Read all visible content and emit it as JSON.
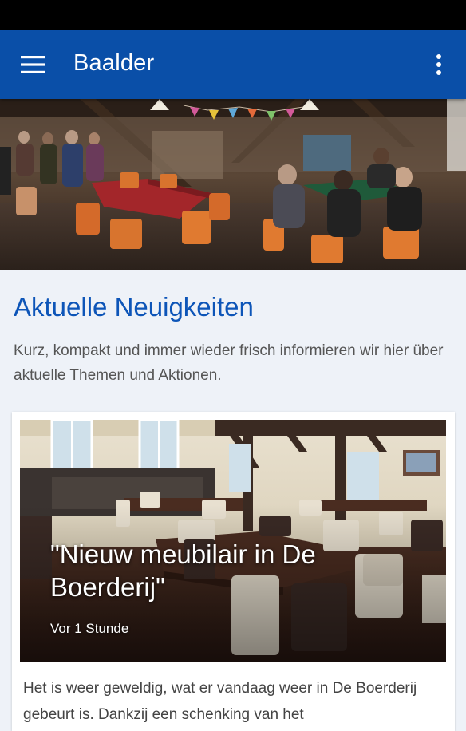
{
  "app": {
    "title": "Baalder",
    "primary_color": "#0a4fa8",
    "menu_icon": "hamburger-menu-icon",
    "overflow_icon": "more-vert-icon"
  },
  "news": {
    "section_title": "Aktuelle Neuigkeiten",
    "intro": "Kurz, kompakt und immer wieder frisch informieren wir hier über aktuelle Themen und Aktionen.",
    "items": [
      {
        "headline": "\"Nieuw meubilair in De Boerderij\"",
        "time": "Vor 1 Stunde",
        "excerpt": "Het is weer geweldig, wat er vandaag weer in De Boerderij gebeurt is. Dankzij een schenking van het"
      }
    ]
  }
}
